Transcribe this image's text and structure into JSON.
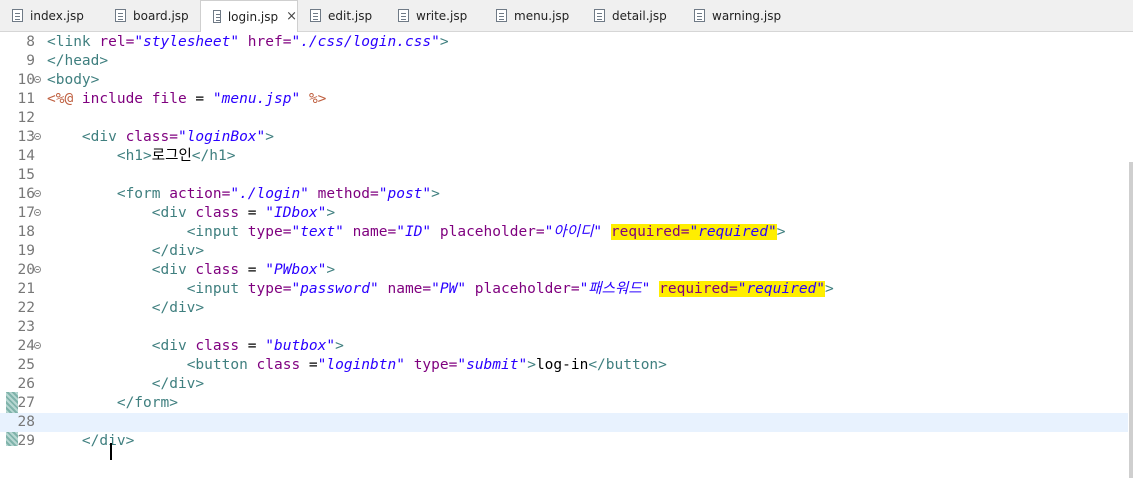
{
  "tabs": [
    {
      "label": "index.jsp"
    },
    {
      "label": "board.jsp"
    },
    {
      "label": "login.jsp",
      "close": "×"
    },
    {
      "label": "edit.jsp"
    },
    {
      "label": "write.jsp"
    },
    {
      "label": "menu.jsp"
    },
    {
      "label": "detail.jsp"
    },
    {
      "label": "warning.jsp"
    }
  ],
  "editor": {
    "lines": [
      {
        "n": "8",
        "tokens": [
          [
            "tag",
            "<link "
          ],
          [
            "attr",
            "rel="
          ],
          [
            "val",
            "\"stylesheet\""
          ],
          [
            "attr",
            " href="
          ],
          [
            "val",
            "\"./css/login.css\""
          ],
          [
            "tag",
            ">"
          ]
        ]
      },
      {
        "n": "9",
        "tokens": [
          [
            "tag",
            "</head>"
          ]
        ]
      },
      {
        "n": "10",
        "tokens": [
          [
            "tag",
            "<body>"
          ]
        ]
      },
      {
        "n": "11",
        "tokens": [
          [
            "dir",
            "<%@"
          ],
          [
            "attr",
            " include"
          ],
          [
            "attr",
            " file"
          ],
          [
            "plain",
            " = "
          ],
          [
            "val",
            "\"menu.jsp\""
          ],
          [
            "dir",
            " %>"
          ]
        ]
      },
      {
        "n": "12",
        "tokens": []
      },
      {
        "n": "13",
        "tokens": [
          [
            "plain",
            "    "
          ],
          [
            "tag",
            "<div "
          ],
          [
            "attr",
            "class="
          ],
          [
            "val",
            "\"loginBox\""
          ],
          [
            "tag",
            ">"
          ]
        ]
      },
      {
        "n": "14",
        "tokens": [
          [
            "plain",
            "        "
          ],
          [
            "tag",
            "<h1>"
          ],
          [
            "plain",
            "로그인"
          ],
          [
            "tag",
            "</h1>"
          ]
        ]
      },
      {
        "n": "15",
        "tokens": []
      },
      {
        "n": "16",
        "tokens": [
          [
            "plain",
            "        "
          ],
          [
            "tag",
            "<form "
          ],
          [
            "attr",
            "action="
          ],
          [
            "val",
            "\"./login\""
          ],
          [
            "attr",
            " method="
          ],
          [
            "val",
            "\"post\""
          ],
          [
            "tag",
            ">"
          ]
        ]
      },
      {
        "n": "17",
        "tokens": [
          [
            "plain",
            "            "
          ],
          [
            "tag",
            "<div "
          ],
          [
            "attr",
            "class"
          ],
          [
            "plain",
            " = "
          ],
          [
            "val",
            "\"IDbox\""
          ],
          [
            "tag",
            ">"
          ]
        ]
      },
      {
        "n": "18",
        "tokens": [
          [
            "plain",
            "                "
          ],
          [
            "tag",
            "<input "
          ],
          [
            "attr",
            "type="
          ],
          [
            "val",
            "\"text\""
          ],
          [
            "attr",
            " name="
          ],
          [
            "val",
            "\"ID\""
          ],
          [
            "attr",
            " placeholder="
          ],
          [
            "val",
            "\"아이디\""
          ],
          [
            "plain",
            " "
          ],
          [
            "hlattr",
            "required="
          ],
          [
            "hlval",
            "\"required\""
          ],
          [
            "tag",
            ">"
          ]
        ]
      },
      {
        "n": "19",
        "tokens": [
          [
            "plain",
            "            "
          ],
          [
            "tag",
            "</div>"
          ]
        ]
      },
      {
        "n": "20",
        "tokens": [
          [
            "plain",
            "            "
          ],
          [
            "tag",
            "<div "
          ],
          [
            "attr",
            "class"
          ],
          [
            "plain",
            " = "
          ],
          [
            "val",
            "\"PWbox\""
          ],
          [
            "tag",
            ">"
          ]
        ]
      },
      {
        "n": "21",
        "tokens": [
          [
            "plain",
            "                "
          ],
          [
            "tag",
            "<input "
          ],
          [
            "attr",
            "type="
          ],
          [
            "val",
            "\"password\""
          ],
          [
            "attr",
            " name="
          ],
          [
            "val",
            "\"PW\""
          ],
          [
            "attr",
            " placeholder="
          ],
          [
            "val",
            "\"패스워드\""
          ],
          [
            "plain",
            " "
          ],
          [
            "hlattr",
            "required="
          ],
          [
            "hlval",
            "\"required\""
          ],
          [
            "tag",
            ">"
          ]
        ]
      },
      {
        "n": "22",
        "tokens": [
          [
            "plain",
            "            "
          ],
          [
            "tag",
            "</div>"
          ]
        ]
      },
      {
        "n": "23",
        "tokens": []
      },
      {
        "n": "24",
        "tokens": [
          [
            "plain",
            "            "
          ],
          [
            "tag",
            "<div "
          ],
          [
            "attr",
            "class"
          ],
          [
            "plain",
            " = "
          ],
          [
            "val",
            "\"butbox\""
          ],
          [
            "tag",
            ">"
          ]
        ]
      },
      {
        "n": "25",
        "tokens": [
          [
            "plain",
            "                "
          ],
          [
            "tag",
            "<button "
          ],
          [
            "attr",
            "class"
          ],
          [
            "plain",
            " ="
          ],
          [
            "val",
            "\"loginbtn\""
          ],
          [
            "attr",
            " type="
          ],
          [
            "val",
            "\"submit\""
          ],
          [
            "tag",
            ">"
          ],
          [
            "plain",
            "log-in"
          ],
          [
            "tag",
            "</button>"
          ]
        ]
      },
      {
        "n": "26",
        "tokens": [
          [
            "plain",
            "            "
          ],
          [
            "tag",
            "</div>"
          ]
        ]
      },
      {
        "n": "27",
        "tokens": [
          [
            "plain",
            "        "
          ],
          [
            "tag",
            "</form>"
          ]
        ]
      },
      {
        "n": "28",
        "tokens": []
      },
      {
        "n": "29",
        "tokens": [
          [
            "plain",
            "    "
          ],
          [
            "tag",
            "</div>"
          ]
        ]
      }
    ]
  },
  "colors": {
    "tag": "#3f7f7f",
    "attr": "#7f007f",
    "value": "#2a00ff",
    "directive": "#bf5f3f",
    "highlight": "#ffee00",
    "current_line": "#e8f2fe"
  }
}
